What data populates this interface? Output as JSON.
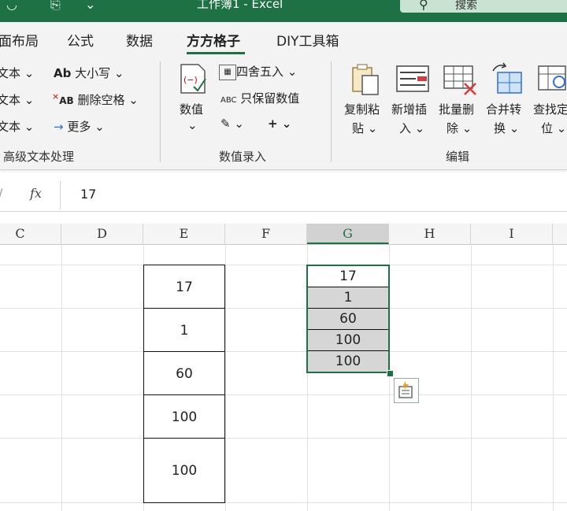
{
  "titlebar": {
    "title": "工作簿1 - Excel",
    "search_label": "搜索",
    "accent": "#1e7145"
  },
  "tabs": [
    {
      "label": "面布局"
    },
    {
      "label": "公式"
    },
    {
      "label": "数据"
    },
    {
      "label": "方方格子",
      "active": true
    },
    {
      "label": "DIY工具箱"
    }
  ],
  "ribbon": {
    "text_group": {
      "left_items": [
        "文本",
        "文本",
        "文本"
      ],
      "case_label": "大小写",
      "case_glyph": "Ab",
      "delete_space_label": "删除空格",
      "delete_space_glyph": "AB",
      "more_label": "更多",
      "group_label": "高级文本处理"
    },
    "number_group": {
      "value_label": "数值",
      "round_label": "四舍五入",
      "keep_value_label": "只保留数值",
      "keep_value_glyph": "ABC",
      "plus_glyph": "+",
      "group_label": "数值录入"
    },
    "edit_group": {
      "buttons": [
        {
          "line1": "复制粘",
          "line2": "贴"
        },
        {
          "line1": "新增插",
          "line2": "入"
        },
        {
          "line1": "批量删",
          "line2": "除"
        },
        {
          "line1": "合并转",
          "line2": "换"
        },
        {
          "line1": "查找定",
          "line2": "位"
        }
      ],
      "group_label": "编辑"
    }
  },
  "formula_bar": {
    "fx_label": "fx",
    "value": "17"
  },
  "columns": [
    "C",
    "D",
    "E",
    "F",
    "G",
    "H",
    "I"
  ],
  "selected_column": "G",
  "column_e_values": [
    "17",
    "1",
    "60",
    "100",
    "100"
  ],
  "column_g_values": [
    "17",
    "1",
    "60",
    "100",
    "100"
  ]
}
